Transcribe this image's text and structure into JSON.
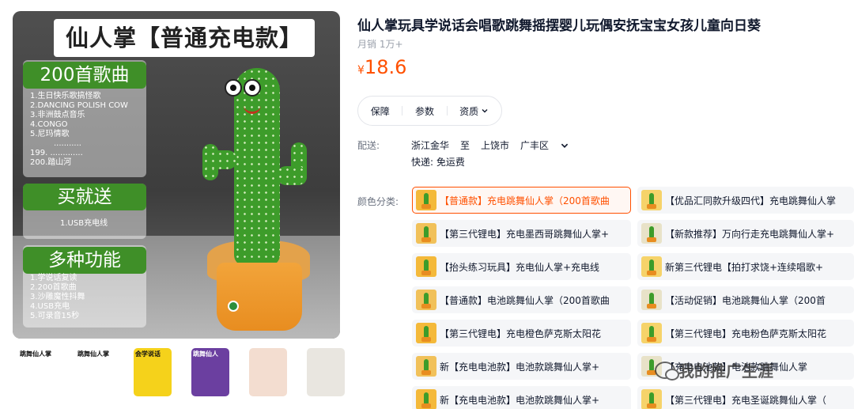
{
  "gallery": {
    "banner_title": "仙人掌【普通充电款】",
    "features": [
      {
        "heading": "200首歌曲",
        "items": [
          "1.生日快乐歌搞怪歌",
          "2.DANCING POLISH COW",
          "3.非洲鼓点音乐",
          "4.CONGO",
          "5.尼玛情歌",
          "...........",
          "199. .............",
          "200.踏山河"
        ]
      },
      {
        "heading": "买就送",
        "items": [
          "1.USB充电线"
        ]
      },
      {
        "heading": "多种功能",
        "items": [
          "1.学说话复读",
          "2.200首歌曲",
          "3.沙雕魔性抖舞",
          "4.USB充电",
          "5.可录音15秒"
        ]
      }
    ],
    "thumbnails": [
      {
        "caption": "跳舞仙人掌",
        "bg": "#ffffff"
      },
      {
        "caption": "跳舞仙人掌",
        "bg": "#ffffff"
      },
      {
        "caption": "会学说话",
        "bg": "#f5d21b"
      },
      {
        "caption": "跳舞仙人",
        "bg": "#6b3fa0"
      },
      {
        "caption": "",
        "bg": "#f3ddd0"
      },
      {
        "caption": "",
        "bg": "#e9e6e0"
      }
    ]
  },
  "product": {
    "title": "仙人掌玩具学说话会唱歌跳舞摇摆婴儿玩偶安抚宝宝女孩儿童向日葵",
    "sales": "月销 1万+",
    "currency": "¥",
    "price": "18.6",
    "price_color": "#ff5000"
  },
  "tabs": [
    {
      "label": "保障"
    },
    {
      "label": "参数"
    },
    {
      "label": "资质"
    }
  ],
  "shipping": {
    "label": "配送:",
    "from": "浙江金华",
    "to_word": "至",
    "city": "上饶市",
    "district": "广丰区",
    "fee": "快递: 免运费"
  },
  "sku": {
    "label": "颜色分类:",
    "options": [
      {
        "text": "【普通款】充电跳舞仙人掌（200首歌曲",
        "selected": true
      },
      {
        "text": "【优品汇同款升级四代】充电跳舞仙人掌",
        "selected": false
      },
      {
        "text": "【第三代锂电】充电墨西哥跳舞仙人掌+",
        "selected": false
      },
      {
        "text": "【新款推荐】万向行走充电跳舞仙人掌+",
        "selected": false
      },
      {
        "text": "【抬头练习玩具】充电仙人掌+充电线",
        "selected": false
      },
      {
        "text": "新第三代锂电【拍打求饶+连续唱歌+",
        "selected": false
      },
      {
        "text": "【普通款】电池跳舞仙人掌（200首歌曲",
        "selected": false
      },
      {
        "text": "【活动促销】电池跳舞仙人掌（200首",
        "selected": false
      },
      {
        "text": "【第三代锂电】充电橙色萨克斯太阳花",
        "selected": false
      },
      {
        "text": "【第三代锂电】充电粉色萨克斯太阳花",
        "selected": false
      },
      {
        "text": "新【充电电池款】电池款跳舞仙人掌+",
        "selected": false
      },
      {
        "text": "【充电电池款】电池款跳舞仙人掌",
        "selected": false
      },
      {
        "text": "新【充电电池款】电池款跳舞仙人掌+",
        "selected": false
      },
      {
        "text": "【第三代锂电】充电圣诞跳舞仙人掌（",
        "selected": false
      }
    ]
  },
  "watermark": "我的推广生涯"
}
